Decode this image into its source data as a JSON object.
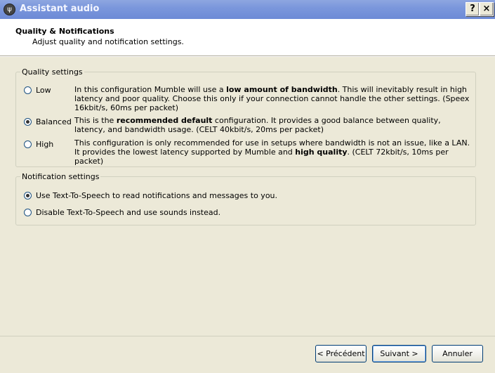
{
  "window": {
    "title": "Assistant audio",
    "help_glyph": "?",
    "close_glyph": "×"
  },
  "header": {
    "title": "Quality & Notifications",
    "subtitle": "Adjust quality and notification settings."
  },
  "quality": {
    "legend": "Quality settings",
    "options": [
      {
        "label": "Low",
        "selected": false,
        "desc_pre": "In this configuration Mumble will use a ",
        "desc_bold": "low amount of bandwidth",
        "desc_post": ". This will inevitably result in high latency and poor quality. Choose this only if your connection cannot handle the other settings. (Speex 16kbit/s, 60ms per packet)"
      },
      {
        "label": "Balanced",
        "selected": true,
        "desc_pre": "This is the ",
        "desc_bold": "recommended default",
        "desc_post": " configuration. It provides a good balance between quality, latency, and bandwidth usage. (CELT 40kbit/s, 20ms per packet)"
      },
      {
        "label": "High",
        "selected": false,
        "desc_pre": "This configuration is only recommended for use in setups where bandwidth is not an issue, like a LAN. It provides the lowest latency supported by Mumble and ",
        "desc_bold": "high quality",
        "desc_post": ". (CELT 72kbit/s, 10ms per packet)"
      }
    ]
  },
  "notifications": {
    "legend": "Notification settings",
    "options": [
      {
        "label": "Use Text-To-Speech to read notifications and messages to you.",
        "selected": true
      },
      {
        "label": "Disable Text-To-Speech and use sounds instead.",
        "selected": false
      }
    ]
  },
  "buttons": {
    "previous": "< Précédent",
    "next": "Suivant >",
    "cancel": "Annuler"
  }
}
